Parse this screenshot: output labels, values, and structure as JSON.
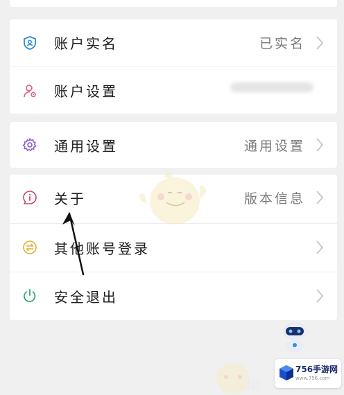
{
  "group1": {
    "items": [
      {
        "label": "账户实名",
        "value": "已实名",
        "icon": "shield-icon"
      },
      {
        "label": "账户设置",
        "value": "",
        "icon": "user-settings-icon"
      }
    ]
  },
  "group2": {
    "items": [
      {
        "label": "通用设置",
        "value": "通用设置",
        "icon": "gear-icon"
      }
    ]
  },
  "group3": {
    "items": [
      {
        "label": "关于",
        "value": "版本信息",
        "icon": "info-icon"
      },
      {
        "label": "其他账号登录",
        "value": "",
        "icon": "switch-account-icon"
      },
      {
        "label": "安全退出",
        "value": "",
        "icon": "power-icon"
      }
    ]
  },
  "watermark": {
    "title": "756手游网",
    "sub": "www.756.com"
  },
  "colors": {
    "shield": "#2d8bd8",
    "user": "#e05a7a",
    "gear": "#8a5cc8",
    "info": "#c84a6a",
    "switch": "#e0b030",
    "power": "#2aa86a",
    "arrow": "#111111"
  }
}
